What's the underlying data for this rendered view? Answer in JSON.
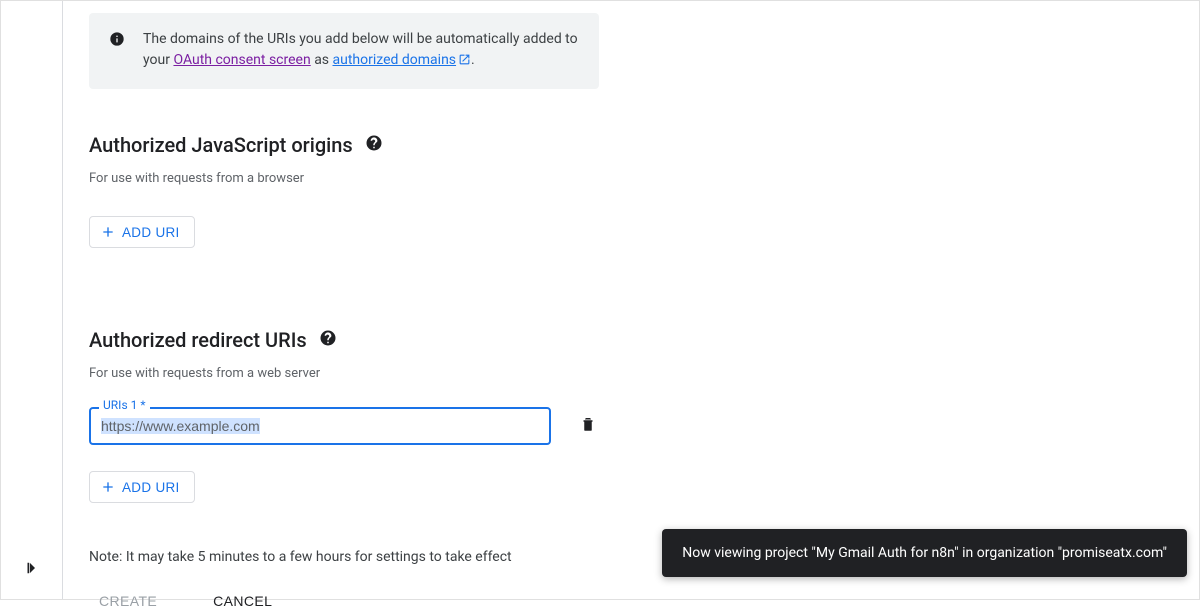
{
  "banner": {
    "text_before": "The domains of the URIs you add below will be automatically added to your ",
    "link_oauth": "OAuth consent screen",
    "text_mid": " as ",
    "link_auth": "authorized domains",
    "text_after": "."
  },
  "js_origins": {
    "title": "Authorized JavaScript origins",
    "subtitle": "For use with requests from a browser",
    "add_button": "ADD URI"
  },
  "redirect_uris": {
    "title": "Authorized redirect URIs",
    "subtitle": "For use with requests from a web server",
    "field_label": "URIs 1 *",
    "field_value": "https://www.example.com",
    "add_button": "ADD URI"
  },
  "note": "Note: It may take 5 minutes to a few hours for settings to take effect",
  "buttons": {
    "create": "CREATE",
    "cancel": "CANCEL"
  },
  "toast": "Now viewing project \"My Gmail Auth for n8n\" in organization \"promiseatx.com\""
}
